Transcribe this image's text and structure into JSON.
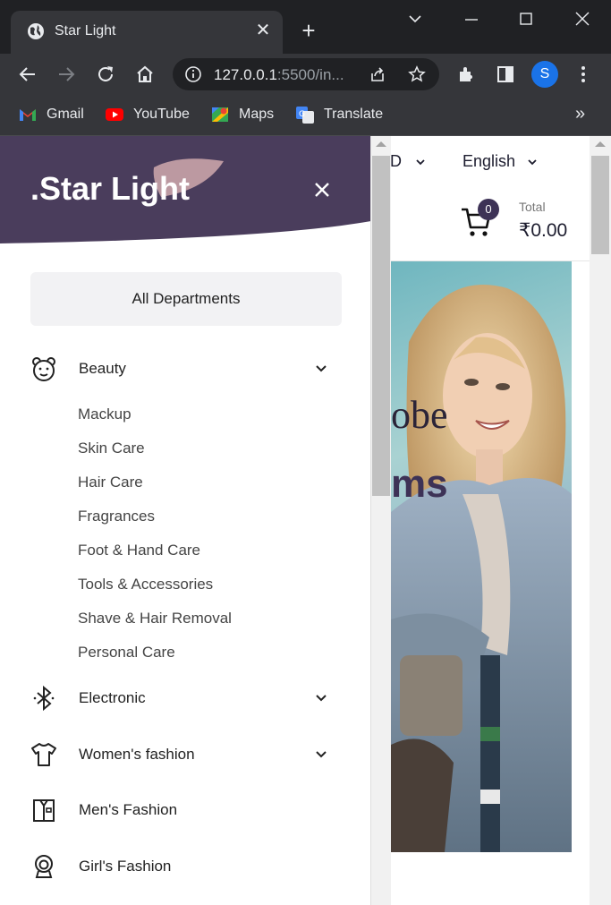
{
  "browser": {
    "tab_title": "Star Light",
    "url_host": "127.0.0.1",
    "url_rest": ":5500/in...",
    "profile_initial": "S",
    "bookmarks": [
      "Gmail",
      "YouTube",
      "Maps",
      "Translate"
    ],
    "bookmarks_overflow": "»"
  },
  "header": {
    "currency_partial": "D",
    "language": "English",
    "cart_count": "0",
    "total_label": "Total",
    "total_value": "₹0.00"
  },
  "hero": {
    "line1": "obe",
    "line2": "ms"
  },
  "drawer": {
    "logo": ".Star Light",
    "all_departments": "All Departments",
    "categories": [
      {
        "label": "Beauty",
        "icon": "bear-icon",
        "expandable": true
      },
      {
        "label": "Electronic",
        "icon": "bluetooth-icon",
        "expandable": true
      },
      {
        "label": "Women's fashion",
        "icon": "tshirt-icon",
        "expandable": true
      },
      {
        "label": "Men's Fashion",
        "icon": "shirt-icon",
        "expandable": false
      },
      {
        "label": "Girl's Fashion",
        "icon": "girl-icon",
        "expandable": false
      }
    ],
    "beauty_subcategories": [
      "Mackup",
      "Skin Care",
      "Hair Care",
      "Fragrances",
      "Foot & Hand Care",
      "Tools & Accessories",
      "Shave & Hair Removal",
      "Personal Care"
    ]
  },
  "colors": {
    "brand_purple": "#3d3256",
    "chrome_dark": "#202124",
    "chrome_tab": "#35363a"
  }
}
